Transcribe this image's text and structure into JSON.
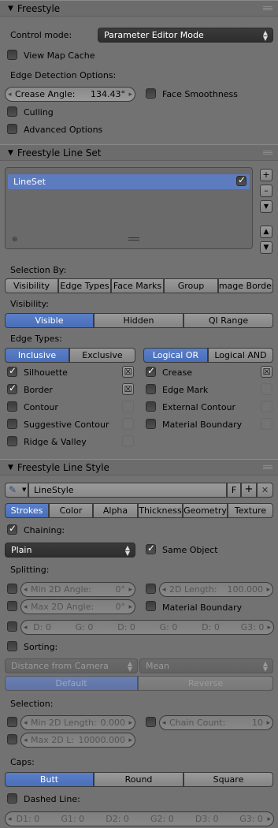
{
  "freestyle": {
    "title": "Freestyle",
    "control_mode_label": "Control mode:",
    "control_mode_value": "Parameter Editor Mode",
    "view_map_cache": "View Map Cache",
    "edge_detection": "Edge Detection Options:",
    "crease_angle_label": "Crease Angle:",
    "crease_angle_value": "134.43°",
    "face_smoothness": "Face Smoothness",
    "culling": "Culling",
    "advanced": "Advanced Options"
  },
  "lineset": {
    "title": "Freestyle Line Set",
    "item": "LineSet",
    "selection_by": "Selection By:",
    "sel_tabs": [
      "Visibility",
      "Edge Types",
      "Face Marks",
      "Group",
      "Image Border"
    ],
    "visibility_label": "Visibility:",
    "vis_tabs": [
      "Visible",
      "Hidden",
      "QI Range"
    ],
    "edge_types_label": "Edge Types:",
    "incl": "Inclusive",
    "excl": "Exclusive",
    "logical_or": "Logical OR",
    "logical_and": "Logical AND",
    "left_types": [
      "Silhouette",
      "Border",
      "Contour",
      "Suggestive Contour",
      "Ridge & Valley"
    ],
    "right_types": [
      "Crease",
      "Edge Mark",
      "External Contour",
      "Material Boundary"
    ]
  },
  "linestyle": {
    "title": "Freestyle Line Style",
    "name": "LineStyle",
    "f": "F",
    "tabs": [
      "Strokes",
      "Color",
      "Alpha",
      "Thickness",
      "Geometry",
      "Texture"
    ],
    "chaining": "Chaining:",
    "plain": "Plain",
    "same_object": "Same Object",
    "splitting": "Splitting:",
    "min2d": "Min 2D Angle:",
    "min2d_v": "0°",
    "max2d": "Max 2D Angle:",
    "max2d_v": "0°",
    "len2d": "2D Length:",
    "len2d_v": "100.000",
    "material_boundary": "Material Boundary",
    "dg": [
      "D: 0",
      "G: 0",
      "D: 0",
      "G: 0",
      "D: 0",
      "G3: 0"
    ],
    "sorting": "Sorting:",
    "dist": "Distance from Camera",
    "mean": "Mean",
    "default": "Default",
    "reverse": "Reverse",
    "selection": "Selection:",
    "minlen": "Min 2D Length:",
    "minlen_v": "0.000",
    "chain_count": "Chain Count:",
    "chain_count_v": "10",
    "maxlen": "Max 2D L:",
    "maxlen_v": "10000.000",
    "caps": "Caps:",
    "caps_tabs": [
      "Butt",
      "Round",
      "Square"
    ],
    "dashed": "Dashed Line:",
    "dash": [
      "D1: 0",
      "G1: 0",
      "D2: 0",
      "G2: 0",
      "D3: 0",
      "G3: 0"
    ]
  }
}
